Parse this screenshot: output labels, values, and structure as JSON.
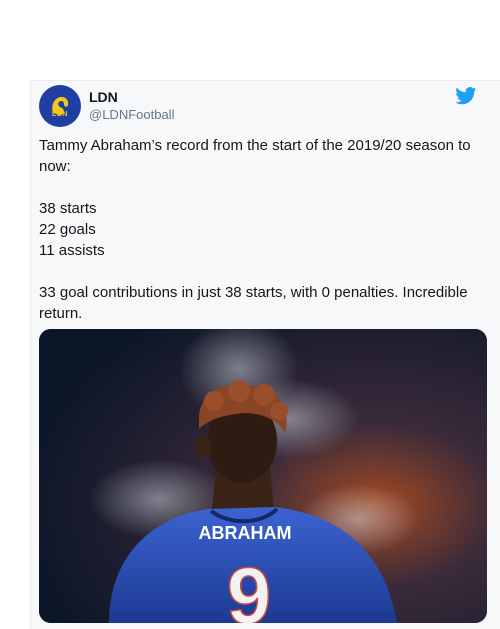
{
  "tweet": {
    "author_name": "LDN",
    "handle": "@LDNFootball",
    "avatar_text": "LDN",
    "lines": [
      "Tammy Abraham’s record from the start of the 2019/20 season to now:",
      "",
      "38 starts",
      "22 goals",
      "11 assists",
      "",
      "33 goal contributions in just 38 starts, with 0 penalties. Incredible return."
    ],
    "media": {
      "shirt_name": "ABRAHAM",
      "shirt_number": "9"
    }
  },
  "icons": {
    "avatar": "lion-icon",
    "brand": "twitter-bird-icon"
  },
  "colors": {
    "accent": "#1da1f2",
    "text": "#14171a",
    "secondary": "#657786",
    "shirt": "#2a4fb8",
    "avatar_bg": "#1f3fa3",
    "avatar_gold": "#f4c81a"
  }
}
